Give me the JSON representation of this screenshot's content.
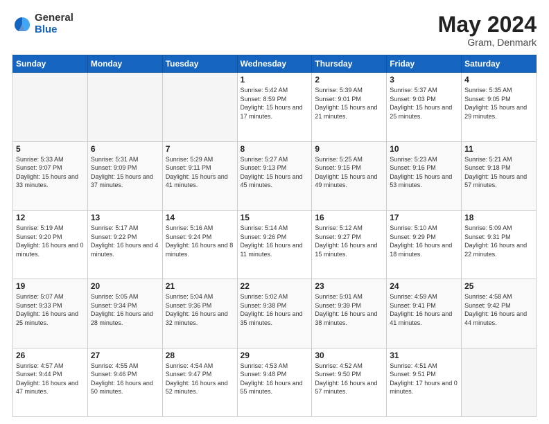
{
  "logo": {
    "general": "General",
    "blue": "Blue"
  },
  "title": {
    "month_year": "May 2024",
    "location": "Gram, Denmark"
  },
  "weekdays": [
    "Sunday",
    "Monday",
    "Tuesday",
    "Wednesday",
    "Thursday",
    "Friday",
    "Saturday"
  ],
  "weeks": [
    [
      {
        "day": "",
        "empty": true
      },
      {
        "day": "",
        "empty": true
      },
      {
        "day": "",
        "empty": true
      },
      {
        "day": "1",
        "sunrise": "5:42 AM",
        "sunset": "8:59 PM",
        "daylight": "15 hours and 17 minutes."
      },
      {
        "day": "2",
        "sunrise": "5:39 AM",
        "sunset": "9:01 PM",
        "daylight": "15 hours and 21 minutes."
      },
      {
        "day": "3",
        "sunrise": "5:37 AM",
        "sunset": "9:03 PM",
        "daylight": "15 hours and 25 minutes."
      },
      {
        "day": "4",
        "sunrise": "5:35 AM",
        "sunset": "9:05 PM",
        "daylight": "15 hours and 29 minutes."
      }
    ],
    [
      {
        "day": "5",
        "sunrise": "5:33 AM",
        "sunset": "9:07 PM",
        "daylight": "15 hours and 33 minutes."
      },
      {
        "day": "6",
        "sunrise": "5:31 AM",
        "sunset": "9:09 PM",
        "daylight": "15 hours and 37 minutes."
      },
      {
        "day": "7",
        "sunrise": "5:29 AM",
        "sunset": "9:11 PM",
        "daylight": "15 hours and 41 minutes."
      },
      {
        "day": "8",
        "sunrise": "5:27 AM",
        "sunset": "9:13 PM",
        "daylight": "15 hours and 45 minutes."
      },
      {
        "day": "9",
        "sunrise": "5:25 AM",
        "sunset": "9:15 PM",
        "daylight": "15 hours and 49 minutes."
      },
      {
        "day": "10",
        "sunrise": "5:23 AM",
        "sunset": "9:16 PM",
        "daylight": "15 hours and 53 minutes."
      },
      {
        "day": "11",
        "sunrise": "5:21 AM",
        "sunset": "9:18 PM",
        "daylight": "15 hours and 57 minutes."
      }
    ],
    [
      {
        "day": "12",
        "sunrise": "5:19 AM",
        "sunset": "9:20 PM",
        "daylight": "16 hours and 0 minutes."
      },
      {
        "day": "13",
        "sunrise": "5:17 AM",
        "sunset": "9:22 PM",
        "daylight": "16 hours and 4 minutes."
      },
      {
        "day": "14",
        "sunrise": "5:16 AM",
        "sunset": "9:24 PM",
        "daylight": "16 hours and 8 minutes."
      },
      {
        "day": "15",
        "sunrise": "5:14 AM",
        "sunset": "9:26 PM",
        "daylight": "16 hours and 11 minutes."
      },
      {
        "day": "16",
        "sunrise": "5:12 AM",
        "sunset": "9:27 PM",
        "daylight": "16 hours and 15 minutes."
      },
      {
        "day": "17",
        "sunrise": "5:10 AM",
        "sunset": "9:29 PM",
        "daylight": "16 hours and 18 minutes."
      },
      {
        "day": "18",
        "sunrise": "5:09 AM",
        "sunset": "9:31 PM",
        "daylight": "16 hours and 22 minutes."
      }
    ],
    [
      {
        "day": "19",
        "sunrise": "5:07 AM",
        "sunset": "9:33 PM",
        "daylight": "16 hours and 25 minutes."
      },
      {
        "day": "20",
        "sunrise": "5:05 AM",
        "sunset": "9:34 PM",
        "daylight": "16 hours and 28 minutes."
      },
      {
        "day": "21",
        "sunrise": "5:04 AM",
        "sunset": "9:36 PM",
        "daylight": "16 hours and 32 minutes."
      },
      {
        "day": "22",
        "sunrise": "5:02 AM",
        "sunset": "9:38 PM",
        "daylight": "16 hours and 35 minutes."
      },
      {
        "day": "23",
        "sunrise": "5:01 AM",
        "sunset": "9:39 PM",
        "daylight": "16 hours and 38 minutes."
      },
      {
        "day": "24",
        "sunrise": "4:59 AM",
        "sunset": "9:41 PM",
        "daylight": "16 hours and 41 minutes."
      },
      {
        "day": "25",
        "sunrise": "4:58 AM",
        "sunset": "9:42 PM",
        "daylight": "16 hours and 44 minutes."
      }
    ],
    [
      {
        "day": "26",
        "sunrise": "4:57 AM",
        "sunset": "9:44 PM",
        "daylight": "16 hours and 47 minutes."
      },
      {
        "day": "27",
        "sunrise": "4:55 AM",
        "sunset": "9:46 PM",
        "daylight": "16 hours and 50 minutes."
      },
      {
        "day": "28",
        "sunrise": "4:54 AM",
        "sunset": "9:47 PM",
        "daylight": "16 hours and 52 minutes."
      },
      {
        "day": "29",
        "sunrise": "4:53 AM",
        "sunset": "9:48 PM",
        "daylight": "16 hours and 55 minutes."
      },
      {
        "day": "30",
        "sunrise": "4:52 AM",
        "sunset": "9:50 PM",
        "daylight": "16 hours and 57 minutes."
      },
      {
        "day": "31",
        "sunrise": "4:51 AM",
        "sunset": "9:51 PM",
        "daylight": "17 hours and 0 minutes."
      },
      {
        "day": "",
        "empty": true
      }
    ]
  ],
  "labels": {
    "sunrise": "Sunrise:",
    "sunset": "Sunset:",
    "daylight": "Daylight:"
  }
}
